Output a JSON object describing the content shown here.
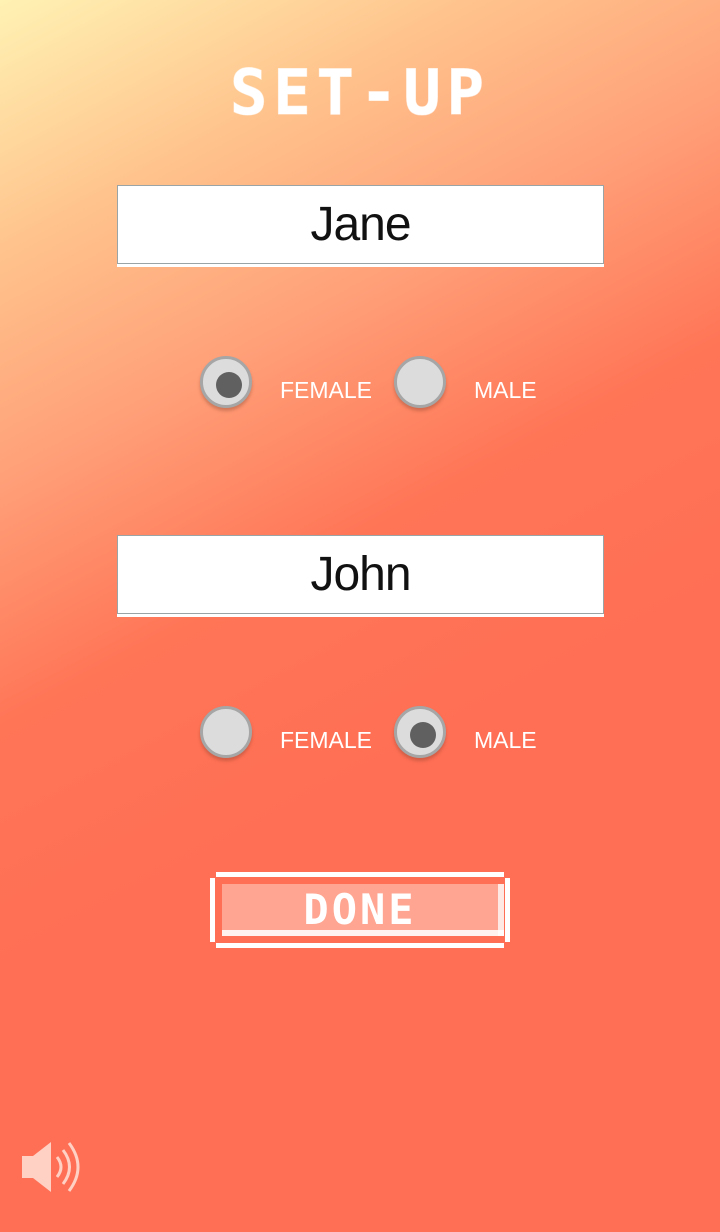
{
  "screen": {
    "title": "SET-UP",
    "accent_color": "#ff6f55"
  },
  "player1": {
    "name": "Jane",
    "gender_options": [
      {
        "label": "FEMALE",
        "selected": true
      },
      {
        "label": "MALE",
        "selected": false
      }
    ]
  },
  "player2": {
    "name": "John",
    "gender_options": [
      {
        "label": "FEMALE",
        "selected": false
      },
      {
        "label": "MALE",
        "selected": true
      }
    ]
  },
  "actions": {
    "done_label": "DONE"
  },
  "footer": {
    "sound_icon": "speaker-volume-icon"
  }
}
